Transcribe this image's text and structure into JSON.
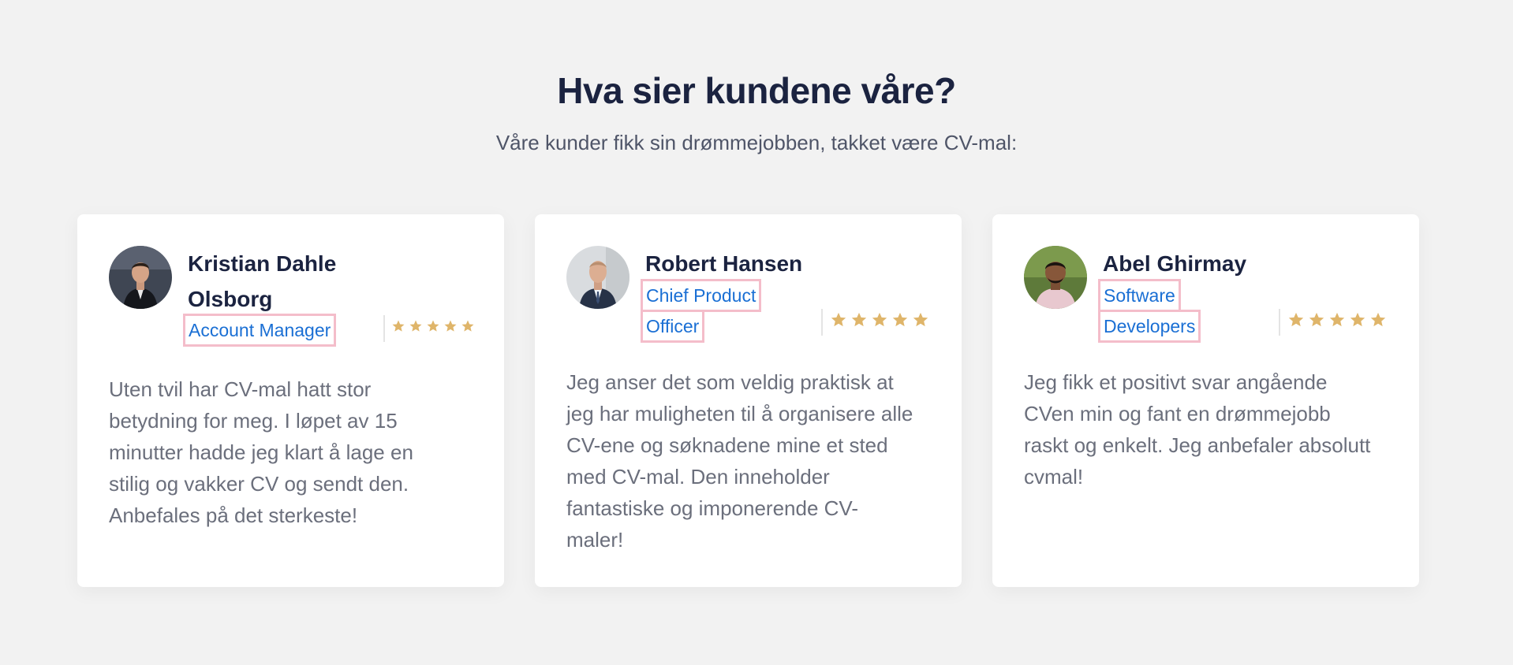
{
  "section": {
    "title": "Hva sier kundene våre?",
    "subtitle": "Våre kunder fikk sin drømmejobben, takket være CV-mal:"
  },
  "colors": {
    "heading": "#1b2340",
    "role": "#1a6fd4",
    "role_highlight_border": "#f4bdca",
    "star": "#dfb56a",
    "body_text": "#6b6f7c",
    "background": "#f2f2f2"
  },
  "testimonials": [
    {
      "name": "Kristian Dahle Olsborg",
      "role_lines": [
        "Account Manager"
      ],
      "rating": 5,
      "text": "Uten tvil har CV-mal hatt stor betydning for meg. I løpet av 15 minutter hadde jeg klart å lage en stilig og vakker CV og sendt den. Anbefales på det sterkeste!"
    },
    {
      "name": "Robert Hansen",
      "role_lines": [
        "Chief Product",
        "Officer"
      ],
      "rating": 5,
      "text": "Jeg anser det som veldig praktisk at jeg har muligheten til å organisere alle CV-ene og søknadene mine et sted med CV-mal. Den inneholder fantastiske og imponerende CV-maler!"
    },
    {
      "name": "Abel Ghirmay",
      "role_lines": [
        "Software",
        "Developers"
      ],
      "rating": 5,
      "text": "Jeg fikk et positivt svar angående CVen min og fant en drømmejobb raskt og enkelt. Jeg anbefaler absolutt cvmal!"
    }
  ]
}
